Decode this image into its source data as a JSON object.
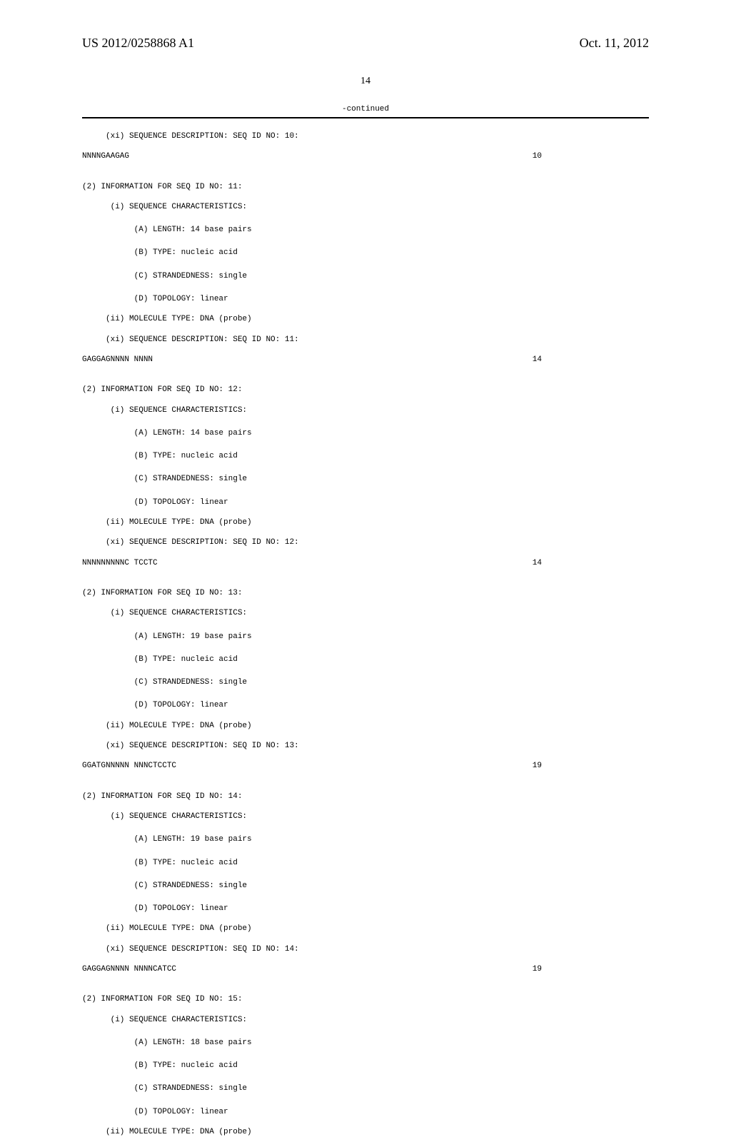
{
  "header": {
    "pub_no": "US 2012/0258868 A1",
    "pub_date": "Oct. 11, 2012"
  },
  "page_number": "14",
  "continued_label": "-continued",
  "sequences": [
    {
      "desc_line": "     (xi) SEQUENCE DESCRIPTION: SEQ ID NO: 10:",
      "seq_text": "NNNNGAAGAG",
      "seq_len": "10"
    },
    {
      "info_header": "(2) INFORMATION FOR SEQ ID NO: 11:",
      "char_header": "      (i) SEQUENCE CHARACTERISTICS:",
      "char_a": "           (A) LENGTH: 14 base pairs",
      "char_b": "           (B) TYPE: nucleic acid",
      "char_c": "           (C) STRANDEDNESS: single",
      "char_d": "           (D) TOPOLOGY: linear",
      "mol_type": "     (ii) MOLECULE TYPE: DNA (probe)",
      "desc_line": "     (xi) SEQUENCE DESCRIPTION: SEQ ID NO: 11:",
      "seq_text": "GAGGAGNNNN NNNN",
      "seq_len": "14"
    },
    {
      "info_header": "(2) INFORMATION FOR SEQ ID NO: 12:",
      "char_header": "      (i) SEQUENCE CHARACTERISTICS:",
      "char_a": "           (A) LENGTH: 14 base pairs",
      "char_b": "           (B) TYPE: nucleic acid",
      "char_c": "           (C) STRANDEDNESS: single",
      "char_d": "           (D) TOPOLOGY: linear",
      "mol_type": "     (ii) MOLECULE TYPE: DNA (probe)",
      "desc_line": "     (xi) SEQUENCE DESCRIPTION: SEQ ID NO: 12:",
      "seq_text": "NNNNNNNNNC TCCTC",
      "seq_len": "14"
    },
    {
      "info_header": "(2) INFORMATION FOR SEQ ID NO: 13:",
      "char_header": "      (i) SEQUENCE CHARACTERISTICS:",
      "char_a": "           (A) LENGTH: 19 base pairs",
      "char_b": "           (B) TYPE: nucleic acid",
      "char_c": "           (C) STRANDEDNESS: single",
      "char_d": "           (D) TOPOLOGY: linear",
      "mol_type": "     (ii) MOLECULE TYPE: DNA (probe)",
      "desc_line": "     (xi) SEQUENCE DESCRIPTION: SEQ ID NO: 13:",
      "seq_text": "GGATGNNNNN NNNCTCCTC",
      "seq_len": "19"
    },
    {
      "info_header": "(2) INFORMATION FOR SEQ ID NO: 14:",
      "char_header": "      (i) SEQUENCE CHARACTERISTICS:",
      "char_a": "           (A) LENGTH: 19 base pairs",
      "char_b": "           (B) TYPE: nucleic acid",
      "char_c": "           (C) STRANDEDNESS: single",
      "char_d": "           (D) TOPOLOGY: linear",
      "mol_type": "     (ii) MOLECULE TYPE: DNA (probe)",
      "desc_line": "     (xi) SEQUENCE DESCRIPTION: SEQ ID NO: 14:",
      "seq_text": "GAGGAGNNNN NNNNCATCC",
      "seq_len": "19"
    },
    {
      "info_header": "(2) INFORMATION FOR SEQ ID NO: 15:",
      "char_header": "      (i) SEQUENCE CHARACTERISTICS:",
      "char_a": "           (A) LENGTH: 18 base pairs",
      "char_b": "           (B) TYPE: nucleic acid",
      "char_c": "           (C) STRANDEDNESS: single",
      "char_d": "           (D) TOPOLOGY: linear",
      "mol_type": "     (ii) MOLECULE TYPE: DNA (probe)"
    }
  ]
}
